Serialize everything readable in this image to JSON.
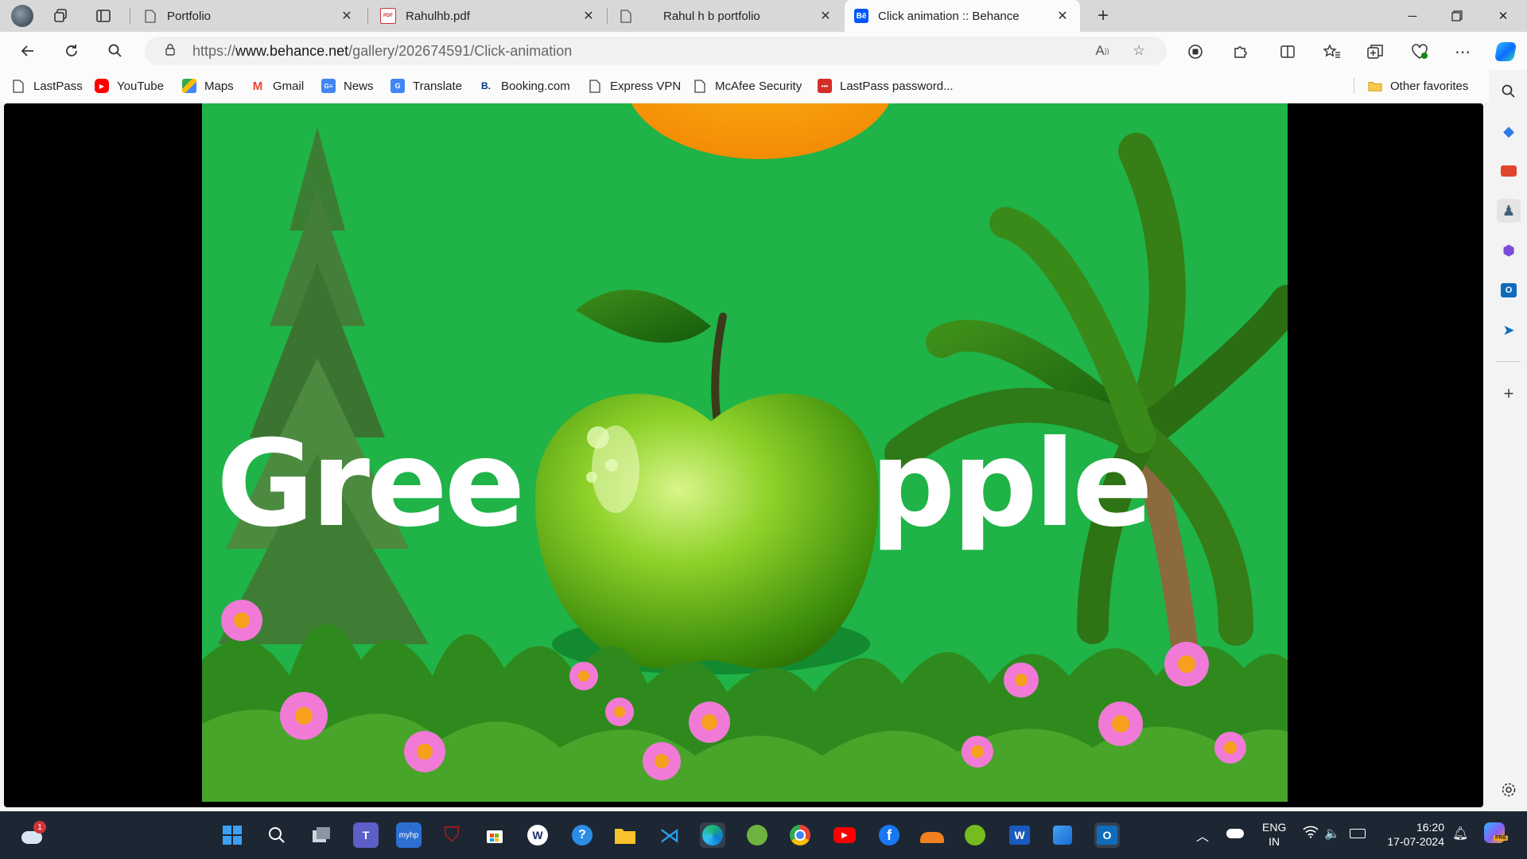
{
  "browser": {
    "tabs": [
      {
        "title": "Portfolio",
        "favicon": "page-icon",
        "active": false
      },
      {
        "title": "Rahulhb.pdf",
        "favicon": "pdf-icon",
        "active": false
      },
      {
        "title": "Rahul h b portfolio",
        "favicon": "page-icon",
        "active": false
      },
      {
        "title": "Click animation :: Behance",
        "favicon": "behance-icon",
        "active": true
      }
    ],
    "behance_favicon_text": "Bē",
    "pdf_favicon_text": "PDF",
    "address": {
      "url_prefix": "https://",
      "url_domain": "www.behance.net",
      "url_path": "/gallery/202674591/Click-animation"
    },
    "bookmarks": [
      {
        "label": "LastPass",
        "icon": "page-icon"
      },
      {
        "label": "YouTube",
        "icon": "youtube-icon"
      },
      {
        "label": "Maps",
        "icon": "maps-icon"
      },
      {
        "label": "Gmail",
        "icon": "gmail-icon"
      },
      {
        "label": "News",
        "icon": "news-icon"
      },
      {
        "label": "Translate",
        "icon": "translate-icon"
      },
      {
        "label": "Booking.com",
        "icon": "booking-icon"
      },
      {
        "label": "Express VPN",
        "icon": "page-icon"
      },
      {
        "label": "McAfee Security",
        "icon": "page-icon"
      },
      {
        "label": "LastPass password...",
        "icon": "lastpass-icon"
      }
    ],
    "other_favorites": "Other favorites"
  },
  "artwork": {
    "headline_left": "Gree",
    "headline_right": "pple",
    "background_color": "#20b347",
    "apple_color": "#6cc21f"
  },
  "taskbar": {
    "weather_badge": "1",
    "language_top": "ENG",
    "language_bottom": "IN",
    "time": "16:20",
    "date": "17-07-2024",
    "store_badge": "PRE"
  },
  "colors": {
    "accent": "#0067c0",
    "taskbar": "#1d2733",
    "tabstrip": "#d8d8d8"
  }
}
